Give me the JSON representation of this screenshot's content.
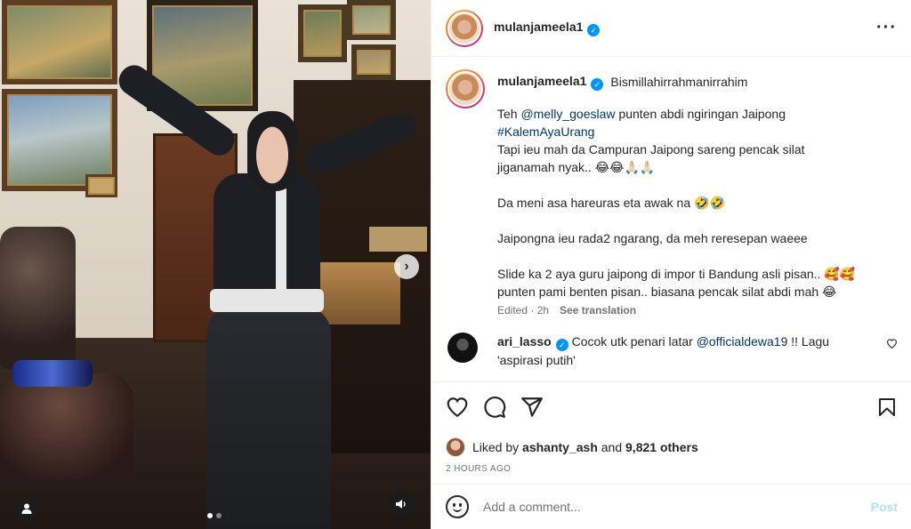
{
  "author": {
    "username": "mulanjameela1",
    "verified": true
  },
  "header": {
    "more_icon": "more-horizontal-icon"
  },
  "media": {
    "slide_count": 2,
    "current_slide": 1,
    "next_icon": "chevron-right-icon",
    "user_tag_icon": "person-icon",
    "audio_icon": "speaker-icon"
  },
  "caption": {
    "first_line": "Bismillahirrahmanirrahim",
    "p1_prefix": "Teh ",
    "p1_mention": "@melly_goeslaw",
    "p1_suffix": " punten abdi ngiringan Jaipong",
    "p1_hashtag": "#KalemAyaUrang",
    "p1_line3": "Tapi ieu mah da Campuran Jaipong sareng pencak silat",
    "p1_line4": "jiganamah nyak.. 😂😂🙏🏻🙏🏻",
    "p2": "Da meni asa hareuras eta awak na 🤣🤣",
    "p3": "Jaipongna ieu rada2 ngarang, da meh reresepan waeee",
    "p4_line1": "Slide ka 2 aya guru jaipong di impor ti Bandung asli pisan.. 🥰🥰",
    "p4_line2": "punten pami benten pisan.. biasana pencak silat abdi mah 😂",
    "edited": "Edited · 2h",
    "see_translation": "See translation"
  },
  "comments": [
    {
      "username": "ari_lasso",
      "verified": true,
      "text_prefix": "Cocok utk penari latar ",
      "mention": "@officialdewa19",
      "text_suffix": " !! Lagu 'aspirasi putih'"
    }
  ],
  "actions": {
    "like_icon": "heart-icon",
    "comment_icon": "comment-icon",
    "share_icon": "send-icon",
    "save_icon": "bookmark-icon"
  },
  "likes": {
    "prefix": "Liked by ",
    "user": "ashanty_ash",
    "middle": " and ",
    "count": "9,821 others"
  },
  "timestamp": "2 HOURS AGO",
  "comment_input": {
    "placeholder": "Add a comment...",
    "post_label": "Post",
    "emoji_icon": "emoji-icon"
  },
  "colors": {
    "accent": "#0095f6",
    "link": "#00376b",
    "muted": "#737373",
    "post_disabled": "#b2dffc"
  }
}
